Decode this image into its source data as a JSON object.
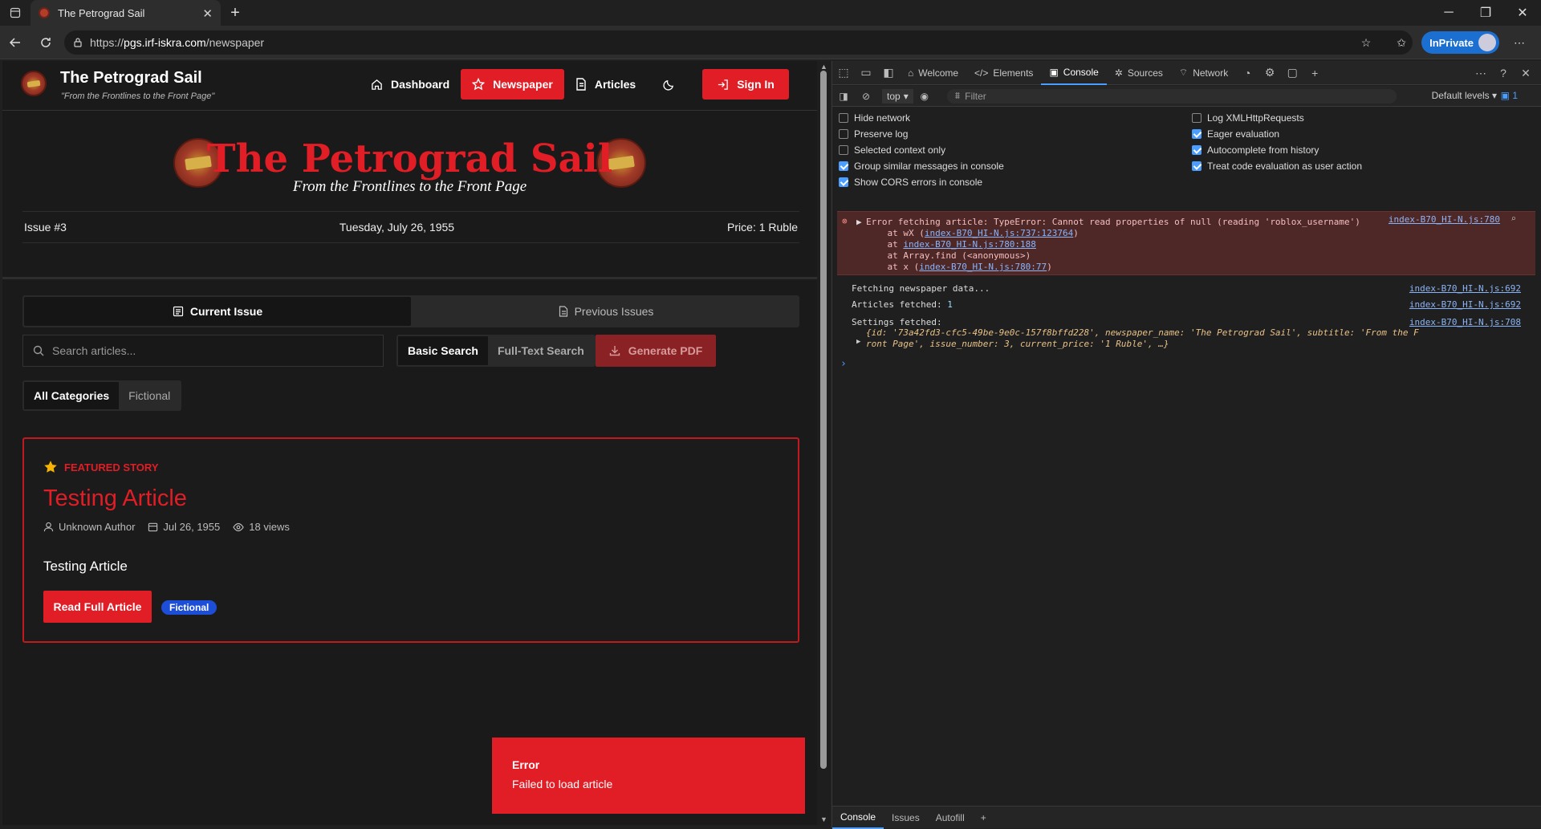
{
  "browser": {
    "tab_title": "The Petrograd Sail",
    "url_prefix": "https://",
    "url_host": "pgs.irf-iskra.com",
    "url_path": "/newspaper",
    "inprivate_label": "InPrivate"
  },
  "site": {
    "name": "The Petrograd Sail",
    "tagline": "\"From the Frontlines to the Front Page\"",
    "nav": {
      "dashboard": "Dashboard",
      "newspaper": "Newspaper",
      "articles": "Articles",
      "signin": "Sign In"
    }
  },
  "masthead": {
    "title": "The Petrograd Sail",
    "subtitle": "From the Frontlines to the Front Page",
    "issue": "Issue #3",
    "date": "Tuesday, July 26, 1955",
    "price": "Price: 1 Ruble"
  },
  "issue_tabs": {
    "current": "Current Issue",
    "previous": "Previous Issues"
  },
  "search": {
    "placeholder": "Search articles...",
    "basic": "Basic Search",
    "fulltext": "Full-Text Search",
    "generate_pdf": "Generate PDF"
  },
  "categories": {
    "all": "All Categories",
    "fictional": "Fictional"
  },
  "featured": {
    "label": "FEATURED STORY",
    "title": "Testing Article",
    "author": "Unknown Author",
    "date": "Jul 26, 1955",
    "views": "18 views",
    "summary": "Testing Article",
    "read_button": "Read Full Article",
    "tag": "Fictional"
  },
  "toast": {
    "title": "Error",
    "message": "Failed to load article"
  },
  "devtools": {
    "tabs": {
      "welcome": "Welcome",
      "elements": "Elements",
      "console": "Console",
      "sources": "Sources",
      "network": "Network"
    },
    "context": "top",
    "filter_placeholder": "Filter",
    "levels": "Default levels",
    "issue_count": "1",
    "settings": {
      "hide_network": "Hide network",
      "preserve_log": "Preserve log",
      "selected_context": "Selected context only",
      "group_similar": "Group similar messages in console",
      "show_cors": "Show CORS errors in console",
      "log_xhr": "Log XMLHttpRequests",
      "eager_eval": "Eager evaluation",
      "autocomplete": "Autocomplete from history",
      "treat_code": "Treat code evaluation as user action"
    },
    "console": {
      "error_line1": "Error fetching article: TypeError: Cannot read properties of null (reading 'roblox_username')",
      "error_at1_pre": "    at wX (",
      "error_at1_link": "index-B70_HI-N.js:737:123764",
      "error_at1_post": ")",
      "error_at2_pre": "    at ",
      "error_at2_link": "index-B70_HI-N.js:780:188",
      "error_at3": "    at Array.find (<anonymous>)",
      "error_at4_pre": "    at x (",
      "error_at4_link": "index-B70_HI-N.js:780:77",
      "error_at4_post": ")",
      "error_source": "index-B70_HI-N.js:780",
      "log1": "Fetching newspaper data...",
      "log1_source": "index-B70_HI-N.js:692",
      "log2_label": "Articles fetched: ",
      "log2_value": "1",
      "log2_source": "index-B70_HI-N.js:692",
      "log3": "Settings fetched:",
      "log3_source": "index-B70_HI-N.js:708",
      "log3_obj1": "{id: '73a42fd3-cfc5-49be-9e0c-157f8bffd228', newspaper_name: 'The Petrograd Sail', subtitle: 'From the F",
      "log3_obj2": "ront Page', issue_number: 3, current_price: '1 Ruble', …}"
    },
    "bottom_tabs": {
      "console": "Console",
      "issues": "Issues",
      "autofill": "Autofill"
    }
  }
}
